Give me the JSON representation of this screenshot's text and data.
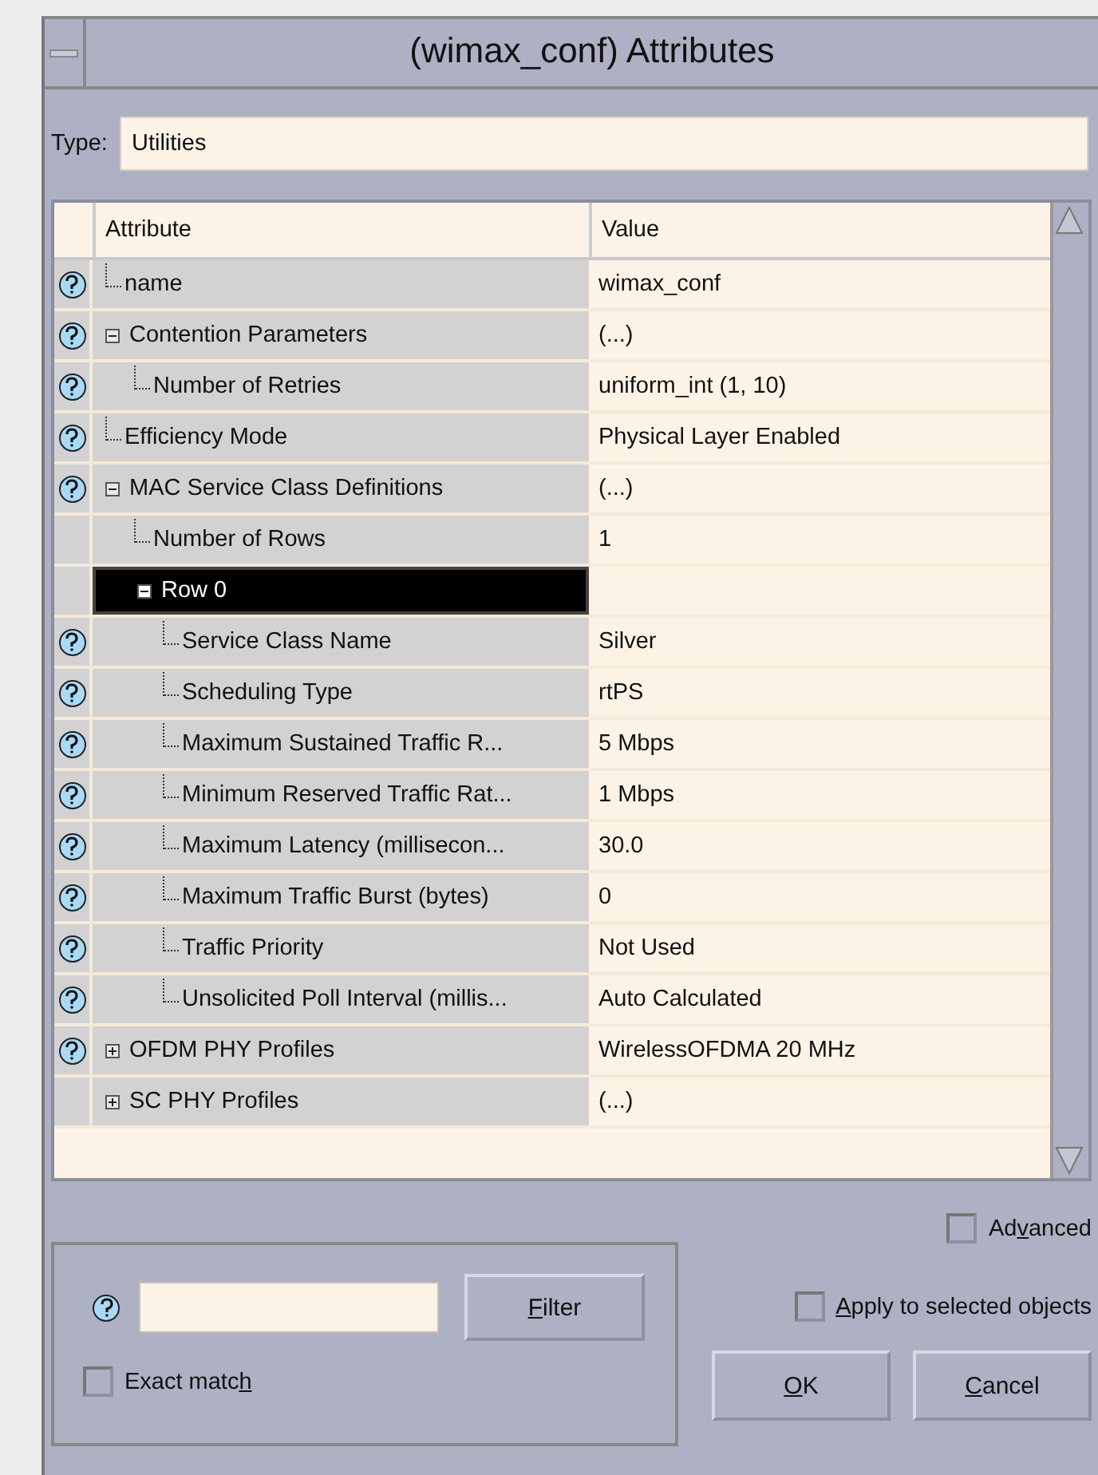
{
  "window": {
    "title": "(wimax_conf) Attributes"
  },
  "type": {
    "label": "Type:",
    "value": "Utilities"
  },
  "table": {
    "columns": [
      "Attribute",
      "Value"
    ],
    "rows": [
      {
        "label": "name",
        "value": "wimax_conf",
        "help": true,
        "selected": false
      },
      {
        "label": "Contention Parameters",
        "value": "(...)",
        "help": true,
        "selected": false,
        "expanded": true,
        "children": [
          {
            "label": "Number of Retries",
            "value": "uniform_int (1, 10)",
            "help": true,
            "selected": false
          }
        ]
      },
      {
        "label": "Efficiency Mode",
        "value": "Physical Layer Enabled",
        "help": true,
        "selected": false
      },
      {
        "label": "MAC Service Class Definitions",
        "value": "(...)",
        "help": true,
        "selected": false,
        "expanded": true,
        "children": [
          {
            "label": "Number of Rows",
            "value": "1",
            "help": false,
            "selected": false
          },
          {
            "label": "Row 0",
            "help": false,
            "selected": true,
            "expanded": true,
            "children": [
              {
                "label": "Service Class Name",
                "value": "Silver",
                "help": true,
                "selected": false
              },
              {
                "label": "Scheduling Type",
                "value": "rtPS",
                "help": true,
                "selected": false
              },
              {
                "label": "Maximum Sustained Traffic R...",
                "value": "5 Mbps",
                "help": true,
                "selected": false
              },
              {
                "label": "Minimum Reserved Traffic Rat...",
                "value": "1 Mbps",
                "help": true,
                "selected": false
              },
              {
                "label": "Maximum Latency (millisecon...",
                "value": "30.0",
                "help": true,
                "selected": false
              },
              {
                "label": "Maximum Traffic Burst (bytes)",
                "value": "0",
                "help": true,
                "selected": false
              },
              {
                "label": "Traffic Priority",
                "value": "Not Used",
                "help": true,
                "selected": false
              },
              {
                "label": "Unsolicited Poll Interval (millis...",
                "value": "Auto Calculated",
                "help": true,
                "selected": false
              }
            ]
          }
        ]
      },
      {
        "label": "OFDM PHY Profiles",
        "value": "WirelessOFDMA 20 MHz",
        "help": true,
        "selected": false,
        "expanded": false
      },
      {
        "label": "SC PHY Profiles",
        "value": "(...)",
        "help": false,
        "selected": false,
        "expanded": false
      }
    ]
  },
  "filter": {
    "button": {
      "key": "F",
      "post": "ilter"
    },
    "exact_match": {
      "label": {
        "pre": "Exact matc",
        "key": "h"
      },
      "checked": false
    }
  },
  "advanced": {
    "label": {
      "pre": "Ad",
      "key": "v",
      "post": "anced"
    },
    "checked": false
  },
  "apply_to_selected": {
    "label": {
      "key": "A",
      "post": "pply to selected objects"
    },
    "checked": false
  },
  "buttons": [
    {
      "key": "O",
      "post": "K"
    },
    {
      "key": "C",
      "post": "ancel"
    }
  ]
}
